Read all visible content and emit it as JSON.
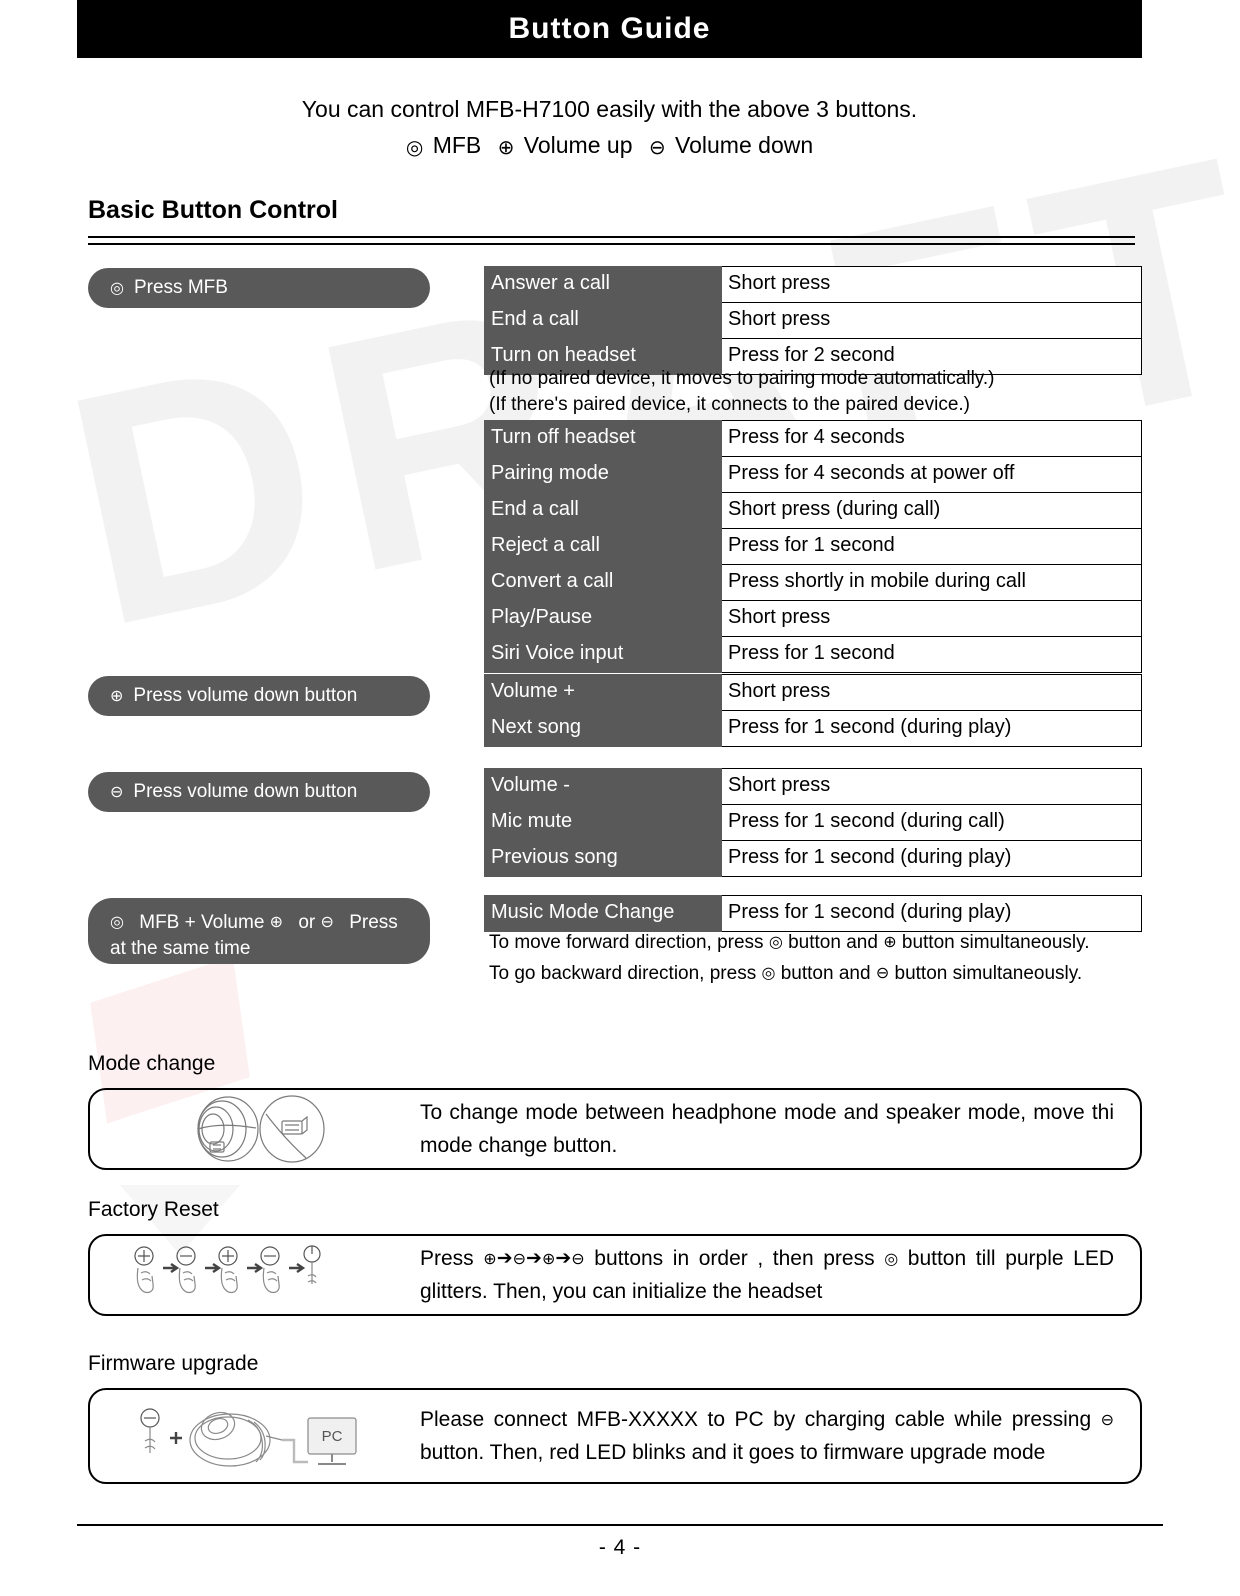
{
  "header": {
    "title": "Button Guide"
  },
  "intro": {
    "line1": "You can control MFB-H7100 easily with the above 3 buttons.",
    "mfb_label": "MFB",
    "volume_up_label": "Volume up",
    "volume_down_label": "Volume down"
  },
  "section": {
    "heading": "Basic Button Control"
  },
  "icons": {
    "mfb": "◎",
    "plus": "⊕",
    "minus": "⊖",
    "arrow": "➔"
  },
  "groups": [
    {
      "pill_label": "Press MFB",
      "pill_icon": "mfb-icon",
      "rows": [
        {
          "action": "Answer a call",
          "how": "Short press"
        },
        {
          "action": "End a call",
          "how": "Short press"
        },
        {
          "action": "Turn on headset",
          "how": "Press for 2 second"
        }
      ],
      "notes": [
        "(If no paired device, it moves to pairing mode automatically.)",
        "(If there's paired device, it connects to the paired device.)"
      ],
      "rows2": [
        {
          "action": "Turn off headset",
          "how": "Press for 4 seconds"
        },
        {
          "action": "Pairing mode",
          "how": "Press for 4 seconds at power off"
        },
        {
          "action": "End a call",
          "how": "Short press (during call)"
        },
        {
          "action": "Reject a call",
          "how": "Press for 1 second"
        },
        {
          "action": "Convert a call",
          "how": "Press shortly in mobile during call"
        },
        {
          "action": "Play/Pause",
          "how": "Short press"
        },
        {
          "action": "Siri Voice input",
          "how": "Press for 1 second"
        }
      ]
    },
    {
      "pill_label": "Press volume down button",
      "pill_icon": "volume-up-icon",
      "rows": [
        {
          "action": "Volume +",
          "how": "Short press"
        },
        {
          "action": "Next song",
          "how": "Press for 1 second (during play)"
        }
      ]
    },
    {
      "pill_label": "Press volume down button",
      "pill_icon": "volume-down-icon",
      "rows": [
        {
          "action": "Volume -",
          "how": "Short press"
        },
        {
          "action": "Mic mute",
          "how": "Press for 1 second (during call)"
        },
        {
          "action": "Previous song",
          "how": "Press for 1 second (during play)"
        }
      ]
    },
    {
      "pill_prefix": "MFB + Volume",
      "pill_mid": "or",
      "pill_suffix": "Press",
      "pill_line2": "at the same time",
      "rows": [
        {
          "action": "Music Mode Change",
          "how": "Press for 1 second (during play)"
        }
      ],
      "notes": [
        "To move forward direction, press",
        "To go backward direction, press"
      ],
      "note_mid": "button and",
      "note_end": "button simultaneously."
    }
  ],
  "mode_change": {
    "heading": "Mode change",
    "text": "To change mode between headphone mode and speaker mode, move thi mode change button."
  },
  "factory_reset": {
    "heading": "Factory Reset",
    "text_prefix": "Press",
    "text_mid": "buttons in order , then press",
    "text_suffix": "button till purple LED glitters. Then, you can initialize the headset"
  },
  "firmware_upgrade": {
    "heading": "Firmware upgrade",
    "pc_label": "PC",
    "text_prefix": "Please connect MFB-XXXXX to PC by charging cable while pressing",
    "text_suffix": "button. Then, red LED blinks and it goes to firmware upgrade mode"
  },
  "footer": {
    "page_number": "- 4 -"
  },
  "colors": {
    "header_bg": "#000000",
    "key_cell_bg": "#595959",
    "pill_bg": "#595959",
    "text": "#000000"
  }
}
